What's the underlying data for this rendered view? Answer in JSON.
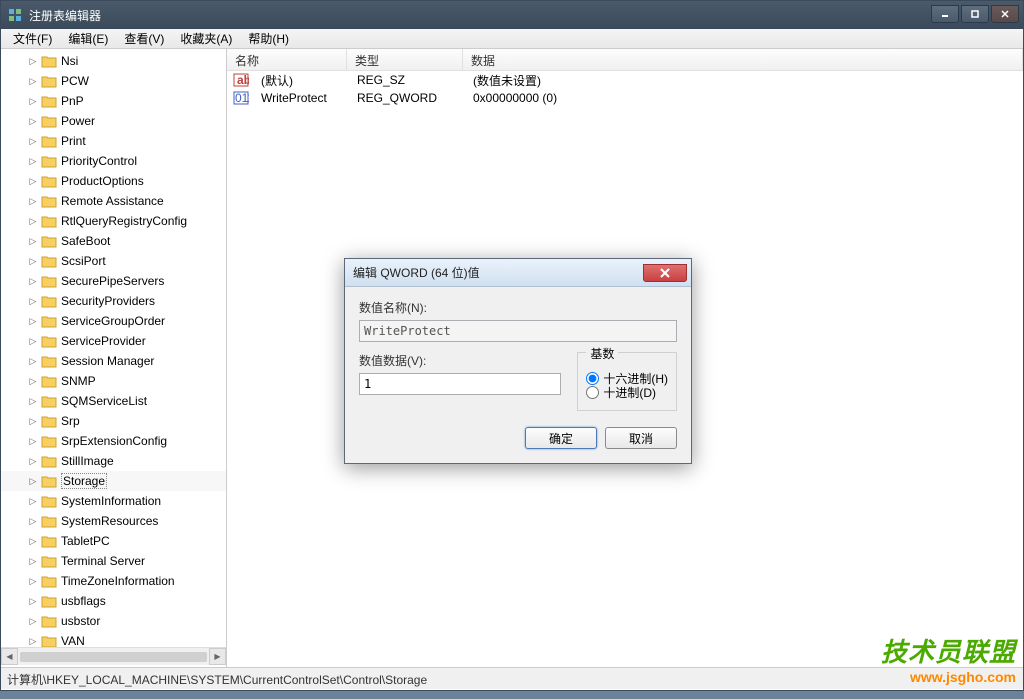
{
  "window": {
    "title": "注册表编辑器"
  },
  "menu": {
    "file": "文件(F)",
    "edit": "编辑(E)",
    "view": "查看(V)",
    "favorites": "收藏夹(A)",
    "help": "帮助(H)"
  },
  "tree": {
    "items": [
      {
        "label": "Nsi"
      },
      {
        "label": "PCW"
      },
      {
        "label": "PnP"
      },
      {
        "label": "Power"
      },
      {
        "label": "Print"
      },
      {
        "label": "PriorityControl"
      },
      {
        "label": "ProductOptions"
      },
      {
        "label": "Remote Assistance"
      },
      {
        "label": "RtlQueryRegistryConfig"
      },
      {
        "label": "SafeBoot"
      },
      {
        "label": "ScsiPort"
      },
      {
        "label": "SecurePipeServers"
      },
      {
        "label": "SecurityProviders"
      },
      {
        "label": "ServiceGroupOrder"
      },
      {
        "label": "ServiceProvider"
      },
      {
        "label": "Session Manager"
      },
      {
        "label": "SNMP"
      },
      {
        "label": "SQMServiceList"
      },
      {
        "label": "Srp"
      },
      {
        "label": "SrpExtensionConfig"
      },
      {
        "label": "StillImage"
      },
      {
        "label": "Storage",
        "selected": true
      },
      {
        "label": "SystemInformation"
      },
      {
        "label": "SystemResources"
      },
      {
        "label": "TabletPC"
      },
      {
        "label": "Terminal Server"
      },
      {
        "label": "TimeZoneInformation"
      },
      {
        "label": "usbflags"
      },
      {
        "label": "usbstor"
      },
      {
        "label": "VAN"
      }
    ]
  },
  "list": {
    "headers": {
      "name": "名称",
      "type": "类型",
      "data": "数据"
    },
    "rows": [
      {
        "icon": "string",
        "name": "(默认)",
        "type": "REG_SZ",
        "data": "(数值未设置)"
      },
      {
        "icon": "binary",
        "name": "WriteProtect",
        "type": "REG_QWORD",
        "data": "0x00000000 (0)"
      }
    ]
  },
  "statusbar": {
    "path": "计算机\\HKEY_LOCAL_MACHINE\\SYSTEM\\CurrentControlSet\\Control\\Storage"
  },
  "dialog": {
    "title": "编辑 QWORD (64 位)值",
    "name_label": "数值名称(N):",
    "name_value": "WriteProtect",
    "data_label": "数值数据(V):",
    "data_value": "1",
    "radix": {
      "group": "基数",
      "hex": "十六进制(H)",
      "dec": "十进制(D)"
    },
    "ok": "确定",
    "cancel": "取消"
  },
  "watermark": {
    "line1": "技术员联盟",
    "line2": "www.jsgho.com"
  }
}
